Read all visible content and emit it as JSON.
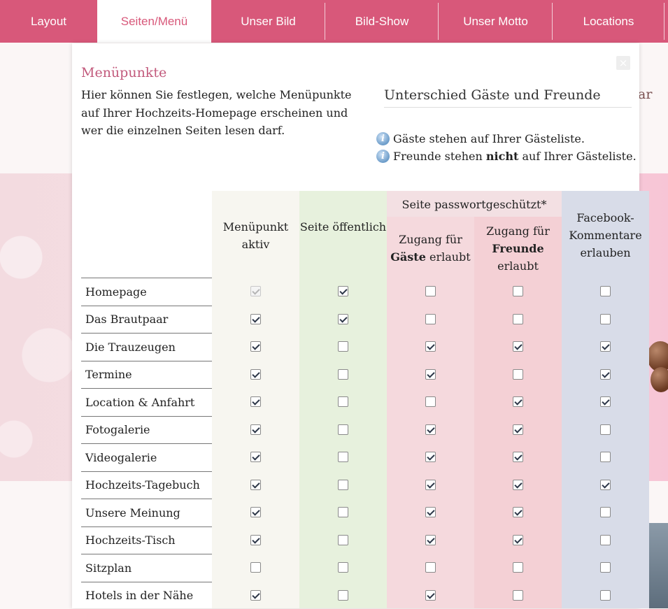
{
  "tabs": [
    {
      "label": "Layout",
      "active": false
    },
    {
      "label": "Seiten/Menü",
      "active": true
    },
    {
      "label": "Unser Bild",
      "active": false
    },
    {
      "label": "Bild-Show",
      "active": false
    },
    {
      "label": "Unser Motto",
      "active": false
    },
    {
      "label": "Locations",
      "active": false
    }
  ],
  "background": {
    "partial_text": "ar"
  },
  "modal": {
    "close_symbol": "×",
    "title": "Menüpunkte",
    "intro": "Hier können Sie festlegen, welche Menüpunkte auf Ihrer Hochzeits-Homepage erscheinen und wer die einzelnen Seiten lesen darf.",
    "diff_title": "Unterschied Gäste und Freunde",
    "info1": "Gäste stehen auf Ihrer Gästeliste.",
    "info2_pre": "Freunde stehen ",
    "info2_bold": "nicht",
    "info2_post": " auf Ihrer Gästeliste."
  },
  "table": {
    "headers": {
      "active": "Menüpunkt aktiv",
      "public": "Seite öffentlich",
      "protected_group": "Seite passwortgeschützt*",
      "guests_pre": "Zugang für",
      "guests_bold": "Gäste",
      "guests_post": "erlaubt",
      "friends_pre": "Zugang für",
      "friends_bold": "Freunde",
      "friends_post": "erlaubt",
      "facebook": "Facebook-Kommentare erlauben"
    },
    "column_colors": {
      "active": "#f7f6f0",
      "public": "#e7f1dd",
      "guests": "#f5d9dd",
      "friends": "#f4d0d5",
      "facebook": "#d8dce8",
      "group_header": "#f3e0e3"
    },
    "rows": [
      {
        "label": "Homepage",
        "active": true,
        "active_disabled": true,
        "public": true,
        "guests": false,
        "friends": false,
        "facebook": false
      },
      {
        "label": "Das Brautpaar",
        "active": true,
        "public": true,
        "guests": false,
        "friends": false,
        "facebook": false
      },
      {
        "label": "Die Trauzeugen",
        "active": true,
        "public": false,
        "guests": true,
        "friends": true,
        "facebook": true
      },
      {
        "label": "Termine",
        "active": true,
        "public": false,
        "guests": true,
        "friends": false,
        "facebook": true
      },
      {
        "label": "Location & Anfahrt",
        "active": true,
        "public": false,
        "guests": false,
        "friends": true,
        "facebook": true
      },
      {
        "label": "Fotogalerie",
        "active": true,
        "public": false,
        "guests": true,
        "friends": true,
        "facebook": false
      },
      {
        "label": "Videogalerie",
        "active": true,
        "public": false,
        "guests": true,
        "friends": true,
        "facebook": false
      },
      {
        "label": "Hochzeits-Tagebuch",
        "active": true,
        "public": false,
        "guests": true,
        "friends": true,
        "facebook": true
      },
      {
        "label": "Unsere Meinung",
        "active": true,
        "public": false,
        "guests": true,
        "friends": true,
        "facebook": false
      },
      {
        "label": "Hochzeits-Tisch",
        "active": true,
        "public": false,
        "guests": true,
        "friends": true,
        "facebook": false
      },
      {
        "label": "Sitzplan",
        "active": false,
        "public": false,
        "guests": false,
        "friends": false,
        "facebook": false
      },
      {
        "label": "Hotels in der Nähe",
        "active": true,
        "public": false,
        "guests": true,
        "friends": false,
        "facebook": false
      }
    ]
  }
}
